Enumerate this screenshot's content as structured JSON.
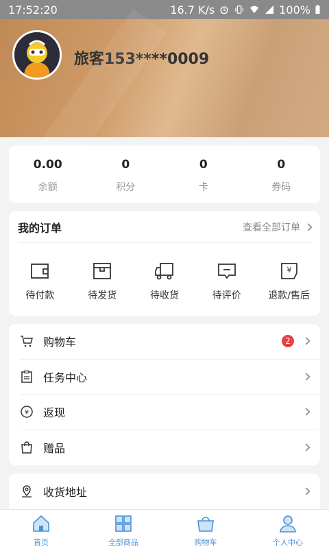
{
  "status_bar": {
    "time": "17:52:20",
    "speed": "16.7 K/s",
    "battery": "100%"
  },
  "profile": {
    "username": "旅客153****0009"
  },
  "stats": [
    {
      "value": "0.00",
      "label": "余额"
    },
    {
      "value": "0",
      "label": "积分"
    },
    {
      "value": "0",
      "label": "卡"
    },
    {
      "value": "0",
      "label": "券码"
    }
  ],
  "orders": {
    "title": "我的订单",
    "view_all": "查看全部订单",
    "items": [
      {
        "label": "待付款",
        "icon": "wallet-icon"
      },
      {
        "label": "待发货",
        "icon": "box-icon"
      },
      {
        "label": "待收货",
        "icon": "truck-icon"
      },
      {
        "label": "待评价",
        "icon": "comment-icon"
      },
      {
        "label": "退款/售后",
        "icon": "refund-icon"
      }
    ]
  },
  "menu": [
    {
      "label": "购物车",
      "icon": "cart-icon",
      "badge": "2"
    },
    {
      "label": "任务中心",
      "icon": "clipboard-icon"
    },
    {
      "label": "返现",
      "icon": "cashback-icon"
    },
    {
      "label": "赠品",
      "icon": "gift-bag-icon"
    }
  ],
  "address": {
    "label": "收货地址",
    "icon": "location-icon"
  },
  "tabbar": [
    {
      "label": "首页",
      "icon": "home-icon"
    },
    {
      "label": "全部商品",
      "icon": "grid-icon"
    },
    {
      "label": "购物车",
      "icon": "basket-icon"
    },
    {
      "label": "个人中心",
      "icon": "user-icon"
    }
  ],
  "colors": {
    "accent": "#4a90d9",
    "badge": "#e84141",
    "header": "#c99660"
  }
}
